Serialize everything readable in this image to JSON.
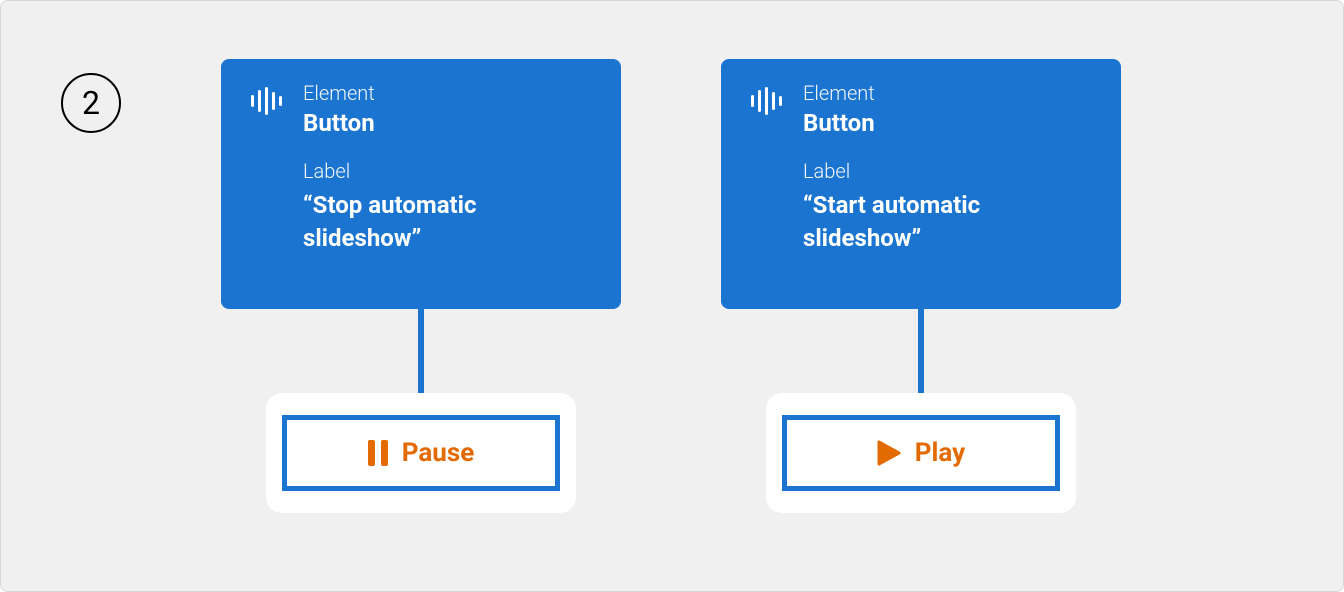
{
  "step_number": "2",
  "items": [
    {
      "element_label": "Element",
      "element_value": "Button",
      "label_label": "Label",
      "label_value": "“Stop automatic slideshow”",
      "button_text": "Pause",
      "button_icon": "pause"
    },
    {
      "element_label": "Element",
      "element_value": "Button",
      "label_label": "Label",
      "label_value": "“Start automatic slideshow”",
      "button_text": "Play",
      "button_icon": "play"
    }
  ]
}
